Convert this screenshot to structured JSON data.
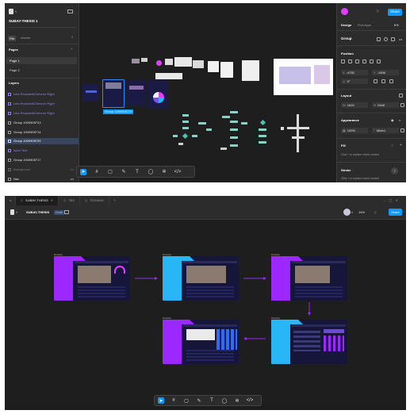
{
  "top": {
    "file_name": "SUBAY-THESIS 1",
    "file_tabs": [
      "File",
      "Assets"
    ],
    "pages_label": "Pages",
    "pages": [
      "Page 1",
      "Page 2"
    ],
    "layers_label": "Layers",
    "layers": [
      "Line Rounded/Chevron Right",
      "Line Rounded/Chevron Right",
      "Line Rounded/Chevron Right",
      "Group 1000905723",
      "Group 1000905714",
      "Group 1000905729",
      "Input Text",
      "Group 1000905717",
      "Background",
      "Nav"
    ],
    "selection_label": "Group 1000905729",
    "right_tabs": [
      "Design",
      "Prototype"
    ],
    "zoom": "6%",
    "share_label": "Share",
    "group_label": "Group",
    "position_label": "Position",
    "x_value": "-4750",
    "y_value": "-1506",
    "rotation_value": "0°",
    "layout_label": "Layout",
    "w_value": "1620",
    "h_value": "2348",
    "appearance_label": "Appearance",
    "opacity_value": "100%",
    "blend_value": "Mixed",
    "fill_label": "Fill",
    "fill_hint": "Click + to replace mixed content",
    "stroke_label": "Stroke",
    "stroke_hint": "Click + to replace mixed content"
  },
  "bottom": {
    "tabs": [
      "SUBAY-THESIS",
      "TBS",
      "TOGMAN"
    ],
    "file_name": "SUBAY-THESIS",
    "badge": "Draft",
    "zoom": "14%",
    "share_label": "Share",
    "frame_label": "Desktop"
  },
  "icons": {
    "move": "cursor-icon",
    "frame": "hash-icon",
    "shape": "square-icon",
    "pen": "pen-icon",
    "text": "text-icon",
    "comment": "comment-icon",
    "actions": "actions-icon",
    "dev": "code-icon"
  },
  "colors": {
    "accent": "#0d99ff",
    "purple": "#9b7bff",
    "magenta": "#9c27ff",
    "cyan": "#29b6f6",
    "avatar": "#e040fb"
  }
}
